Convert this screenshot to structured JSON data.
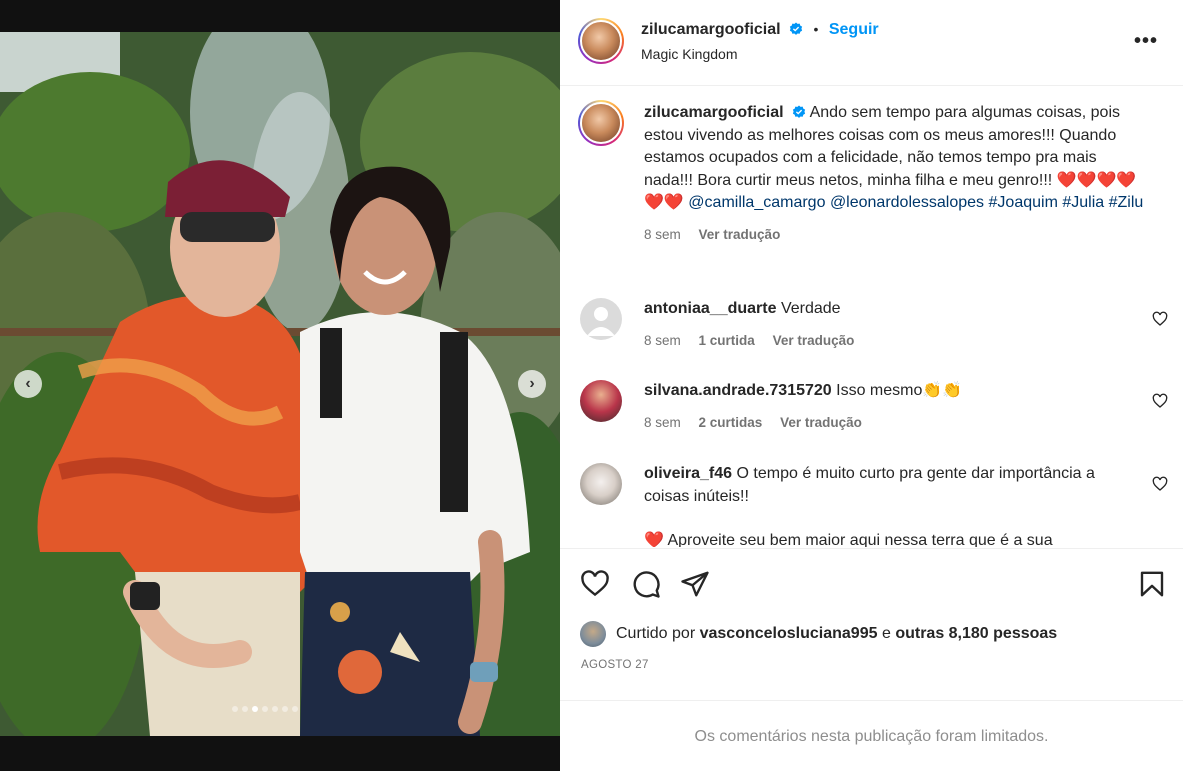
{
  "post": {
    "username": "zilucamargooficial",
    "verified": true,
    "follow_label": "Seguir",
    "location": "Magic Kingdom"
  },
  "caption": {
    "username": "zilucamargooficial",
    "text": "Ando sem tempo para algumas coisas, pois estou vivendo as melhores coisas com os meus amores!!! Quando estamos ocupados com a felicidade, não temos tempo pra mais nada!!! Bora curtir meus netos, minha filha e meu genro!!! ❤️❤️❤️❤️❤️❤️",
    "mention_1": "@camilla_camargo",
    "mention_2": "@leonardolessalopes",
    "hashtag_1": "#Joaquim",
    "hashtag_2": "#Julia",
    "hashtag_3": "#Zilu",
    "time": "8 sem",
    "translate": "Ver tradução"
  },
  "comments": [
    {
      "username": "antoniaa__duarte",
      "text": "Verdade",
      "time": "8 sem",
      "likes": "1 curtida",
      "translate": "Ver tradução"
    },
    {
      "username": "silvana.andrade.7315720",
      "text": "Isso mesmo👏👏",
      "time": "8 sem",
      "likes": "2 curtidas",
      "translate": "Ver tradução"
    },
    {
      "username": "oliveira_f46",
      "text": "O tempo é muito curto pra gente dar importância a coisas inúteis!!",
      "partial_next": "❤️ Aproveite seu bem maior aqui nessa terra que é a sua"
    }
  ],
  "likes": {
    "prefix": "Curtido por",
    "user": "vasconcelosluciana995",
    "connector": "e",
    "others": "outras 8,180 pessoas"
  },
  "date": "AGOSTO 27",
  "limited_notice": "Os comentários nesta publicação foram limitados.",
  "carousel": {
    "count": 7,
    "active_index": 2
  },
  "colors": {
    "link": "#00376b",
    "follow": "#0095f6",
    "muted": "#737373",
    "heart": "#ed4956"
  }
}
